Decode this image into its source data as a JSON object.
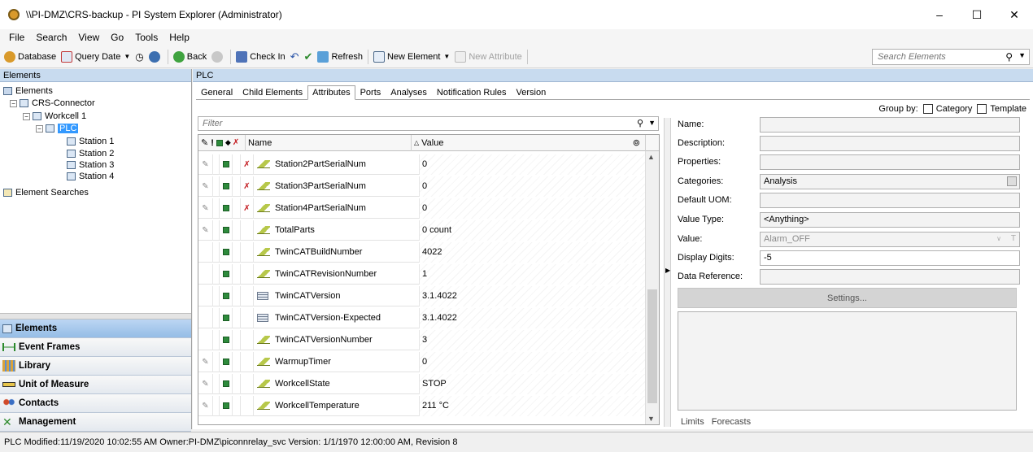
{
  "window": {
    "title": "\\\\PI-DMZ\\CRS-backup - PI System Explorer (Administrator)",
    "minimize": "–",
    "maximize": "☐",
    "close": "✕"
  },
  "menu": [
    "File",
    "Search",
    "View",
    "Go",
    "Tools",
    "Help"
  ],
  "toolbar": {
    "database": "Database",
    "query_date": "Query Date",
    "back": "Back",
    "check_in": "Check In",
    "refresh": "Refresh",
    "new_element": "New Element",
    "new_attribute": "New Attribute",
    "search_placeholder": "Search Elements"
  },
  "left": {
    "header": "Elements",
    "tree": {
      "root": "Elements",
      "connector": "CRS-Connector",
      "workcell": "Workcell 1",
      "plc": "PLC",
      "stations": [
        "Station 1",
        "Station 2",
        "Station 3",
        "Station 4"
      ],
      "searches": "Element Searches"
    },
    "nav": [
      "Elements",
      "Event Frames",
      "Library",
      "Unit of Measure",
      "Contacts",
      "Management"
    ]
  },
  "right": {
    "header": "PLC",
    "tabs": [
      "General",
      "Child Elements",
      "Attributes",
      "Ports",
      "Analyses",
      "Notification Rules",
      "Version"
    ],
    "active_tab": "Attributes",
    "group_by": "Group by:",
    "category": "Category",
    "template": "Template",
    "filter_placeholder": "Filter",
    "col_name": "Name",
    "col_value": "Value",
    "rows": [
      {
        "name": "Station2PartSerialNum",
        "value": "0",
        "edit": true,
        "excluded": true,
        "icon": "pen"
      },
      {
        "name": "Station3PartSerialNum",
        "value": "0",
        "edit": true,
        "excluded": true,
        "icon": "pen"
      },
      {
        "name": "Station4PartSerialNum",
        "value": "0",
        "edit": true,
        "excluded": true,
        "icon": "pen"
      },
      {
        "name": "TotalParts",
        "value": "0 count",
        "edit": true,
        "excluded": false,
        "icon": "pen"
      },
      {
        "name": "TwinCATBuildNumber",
        "value": "4022",
        "edit": false,
        "excluded": false,
        "icon": "pen"
      },
      {
        "name": "TwinCATRevisionNumber",
        "value": "1",
        "edit": false,
        "excluded": false,
        "icon": "pen"
      },
      {
        "name": "TwinCATVersion",
        "value": "3.1.4022",
        "edit": false,
        "excluded": false,
        "icon": "table"
      },
      {
        "name": "TwinCATVersion-Expected",
        "value": "3.1.4022",
        "edit": false,
        "excluded": false,
        "icon": "table"
      },
      {
        "name": "TwinCATVersionNumber",
        "value": "3",
        "edit": false,
        "excluded": false,
        "icon": "pen"
      },
      {
        "name": "WarmupTimer",
        "value": "0",
        "edit": true,
        "excluded": false,
        "icon": "pen"
      },
      {
        "name": "WorkcellState",
        "value": "STOP",
        "edit": true,
        "excluded": false,
        "icon": "pen"
      },
      {
        "name": "WorkcellTemperature",
        "value": "211 °C",
        "edit": true,
        "excluded": false,
        "icon": "pen"
      }
    ]
  },
  "details": {
    "name_label": "Name:",
    "description_label": "Description:",
    "properties_label": "Properties:",
    "categories_label": "Categories:",
    "categories_value": "Analysis",
    "uom_label": "Default UOM:",
    "value_type_label": "Value Type:",
    "value_type_value": "<Anything>",
    "value_label": "Value:",
    "value_value": "Alarm_OFF",
    "display_digits_label": "Display Digits:",
    "display_digits_value": "-5",
    "data_ref_label": "Data Reference:",
    "settings": "Settings...",
    "limits": "Limits",
    "forecasts": "Forecasts"
  },
  "status": "PLC  Modified:11/19/2020 10:02:55 AM Owner:PI-DMZ\\piconnrelay_svc  Version: 1/1/1970 12:00:00 AM, Revision 8"
}
